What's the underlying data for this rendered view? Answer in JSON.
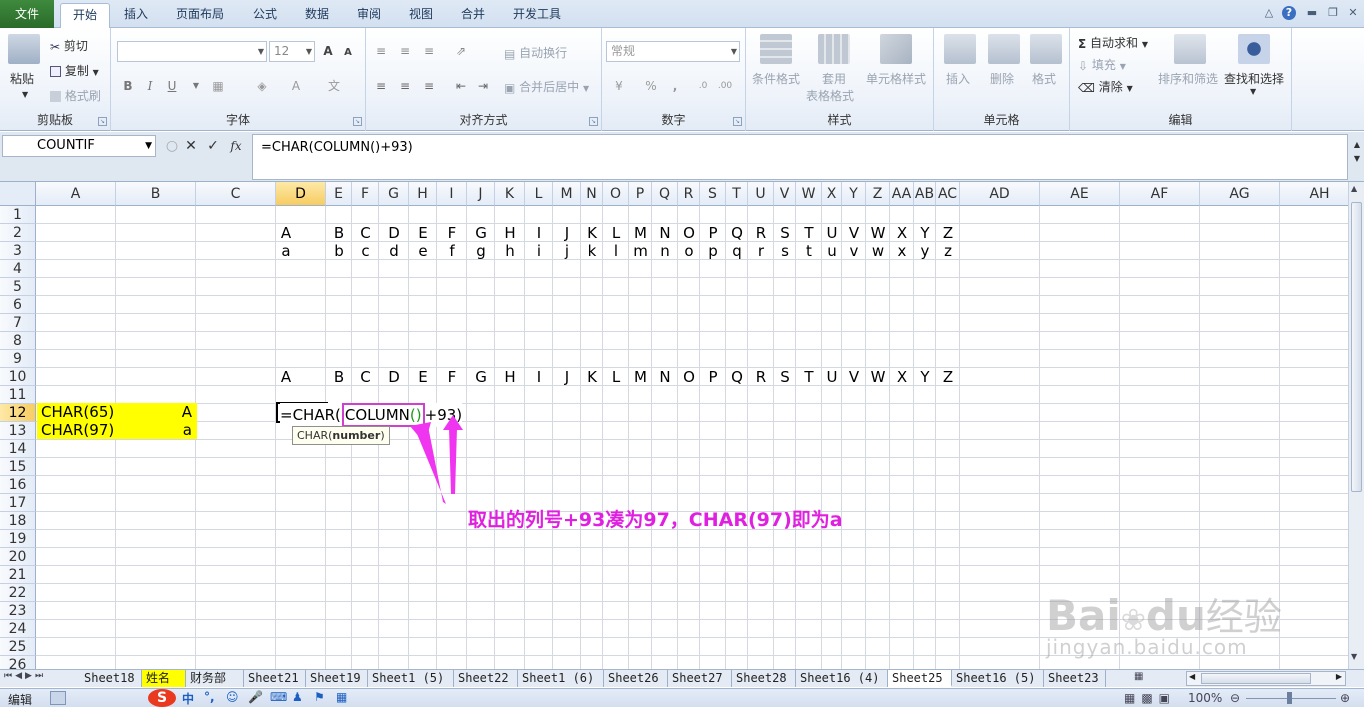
{
  "tabs": [
    "文件",
    "开始",
    "插入",
    "页面布局",
    "公式",
    "数据",
    "审阅",
    "视图",
    "合并",
    "开发工具"
  ],
  "active_tab": "开始",
  "ribbon": {
    "clipboard": {
      "paste": "粘贴",
      "cut": "剪切",
      "copy": "复制",
      "format_painter": "格式刷",
      "label": "剪贴板"
    },
    "font": {
      "size": "12",
      "label": "字体",
      "bold": "B",
      "italic": "I",
      "underline": "U",
      "grow": "A",
      "shrink": "A"
    },
    "alignment": {
      "wrap": "自动换行",
      "merge": "合并后居中",
      "label": "对齐方式"
    },
    "number": {
      "format": "常规",
      "percent": "%",
      "comma": ",",
      "label": "数字"
    },
    "styles": {
      "conditional": "条件格式",
      "table_line1": "套用",
      "table_line2": "表格格式",
      "cell_styles": "单元格样式",
      "label": "样式"
    },
    "cells": {
      "insert": "插入",
      "delete": "删除",
      "format": "格式",
      "label": "单元格"
    },
    "editing": {
      "autosum": "自动求和",
      "fill": "填充",
      "clear": "清除",
      "sort": "排序和筛选",
      "find": "查找和选择",
      "label": "编辑"
    }
  },
  "formula_bar": {
    "name_box": "COUNTIF",
    "formula": "=CHAR(COLUMN()+93)"
  },
  "columns": [
    "A",
    "B",
    "C",
    "D",
    "E",
    "F",
    "G",
    "H",
    "I",
    "J",
    "K",
    "L",
    "M",
    "N",
    "O",
    "P",
    "Q",
    "R",
    "S",
    "T",
    "U",
    "V",
    "W",
    "X",
    "Y",
    "Z",
    "AA",
    "AB",
    "AC",
    "AD",
    "AE",
    "AF",
    "AG",
    "AH"
  ],
  "rows": [
    "1",
    "2",
    "3",
    "4",
    "5",
    "6",
    "7",
    "8",
    "9",
    "10",
    "11",
    "12",
    "13",
    "14",
    "15",
    "16",
    "17",
    "18",
    "19",
    "20",
    "21",
    "22",
    "23",
    "24",
    "25",
    "26"
  ],
  "row2_letters": [
    "A",
    "B",
    "C",
    "D",
    "E",
    "F",
    "G",
    "H",
    "I",
    "J",
    "K",
    "L",
    "M",
    "N",
    "O",
    "P",
    "Q",
    "R",
    "S",
    "T",
    "U",
    "V",
    "W",
    "X",
    "Y",
    "Z"
  ],
  "row3_letters": [
    "a",
    "b",
    "c",
    "d",
    "e",
    "f",
    "g",
    "h",
    "i",
    "j",
    "k",
    "l",
    "m",
    "n",
    "o",
    "p",
    "q",
    "r",
    "s",
    "t",
    "u",
    "v",
    "w",
    "x",
    "y",
    "z"
  ],
  "row10_letters": [
    "A",
    "B",
    "C",
    "D",
    "E",
    "F",
    "G",
    "H",
    "I",
    "J",
    "K",
    "L",
    "M",
    "N",
    "O",
    "P",
    "Q",
    "R",
    "S",
    "T",
    "U",
    "V",
    "W",
    "X",
    "Y",
    "Z"
  ],
  "cells": {
    "a12": "CHAR(65)",
    "b12": "A",
    "a13": "CHAR(97)",
    "b13": "a",
    "edit_prefix": "=CHAR(",
    "edit_func": "COLUMN",
    "edit_paren_open": "(",
    "edit_paren_close": ")",
    "edit_suffix": "+93)"
  },
  "tooltip": {
    "func": "CHAR(",
    "arg": "number",
    "close": ")"
  },
  "annotation": "取出的列号+93凑为97，CHAR(97)即为a",
  "sheet_tabs": [
    "Sheet18",
    "姓名",
    "财务部",
    "Sheet21",
    "Sheet19",
    "Sheet1 (5)",
    "Sheet22",
    "Sheet1 (6)",
    "Sheet26",
    "Sheet27",
    "Sheet28",
    "Sheet16 (4)",
    "Sheet25",
    "Sheet16 (5)",
    "Sheet23"
  ],
  "active_sheet": "Sheet25",
  "status": {
    "mode": "编辑",
    "zoom": "100%",
    "ime": "中"
  },
  "watermark": {
    "brand": "Bai",
    "brand2": "du",
    "cn": "经验",
    "url": "jingyan.baidu.com"
  },
  "colors": {
    "annotation": "#e020e0",
    "highlight": "#ffff00",
    "selected_header": "#f7cc61"
  }
}
